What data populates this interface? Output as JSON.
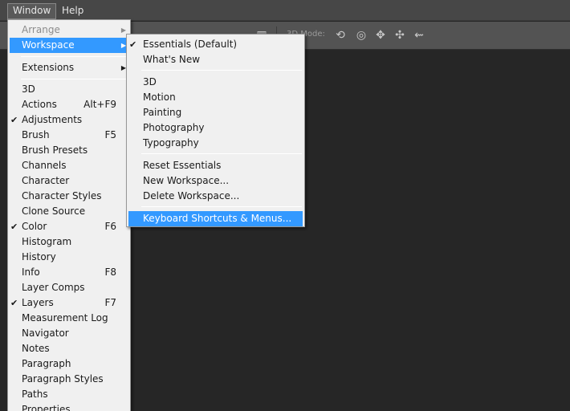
{
  "menubar": {
    "items": [
      "Window",
      "Help"
    ]
  },
  "options_bar": {
    "mode_label": "3D Mode:",
    "icons": [
      "layout-icon",
      "3d-rotate-icon",
      "3d-roll-icon",
      "3d-pan-icon",
      "3d-slide-icon",
      "3d-scale-icon"
    ]
  },
  "window_menu": {
    "arrange": "Arrange",
    "workspace": "Workspace",
    "extensions": "Extensions",
    "items": [
      {
        "label": "3D",
        "shortcut": "",
        "checked": false
      },
      {
        "label": "Actions",
        "shortcut": "Alt+F9",
        "checked": false
      },
      {
        "label": "Adjustments",
        "shortcut": "",
        "checked": true
      },
      {
        "label": "Brush",
        "shortcut": "F5",
        "checked": false
      },
      {
        "label": "Brush Presets",
        "shortcut": "",
        "checked": false
      },
      {
        "label": "Channels",
        "shortcut": "",
        "checked": false
      },
      {
        "label": "Character",
        "shortcut": "",
        "checked": false
      },
      {
        "label": "Character Styles",
        "shortcut": "",
        "checked": false
      },
      {
        "label": "Clone Source",
        "shortcut": "",
        "checked": false
      },
      {
        "label": "Color",
        "shortcut": "F6",
        "checked": true
      },
      {
        "label": "Histogram",
        "shortcut": "",
        "checked": false
      },
      {
        "label": "History",
        "shortcut": "",
        "checked": false
      },
      {
        "label": "Info",
        "shortcut": "F8",
        "checked": false
      },
      {
        "label": "Layer Comps",
        "shortcut": "",
        "checked": false
      },
      {
        "label": "Layers",
        "shortcut": "F7",
        "checked": true
      },
      {
        "label": "Measurement Log",
        "shortcut": "",
        "checked": false
      },
      {
        "label": "Navigator",
        "shortcut": "",
        "checked": false
      },
      {
        "label": "Notes",
        "shortcut": "",
        "checked": false
      },
      {
        "label": "Paragraph",
        "shortcut": "",
        "checked": false
      },
      {
        "label": "Paragraph Styles",
        "shortcut": "",
        "checked": false
      },
      {
        "label": "Paths",
        "shortcut": "",
        "checked": false
      },
      {
        "label": "Properties",
        "shortcut": "",
        "checked": false
      }
    ]
  },
  "workspace_menu": {
    "presets": [
      {
        "label": "Essentials (Default)",
        "checked": true
      },
      {
        "label": "What's New",
        "checked": false
      }
    ],
    "workspaces": [
      "3D",
      "Motion",
      "Painting",
      "Photography",
      "Typography"
    ],
    "actions": [
      "Reset Essentials",
      "New Workspace...",
      "Delete Workspace..."
    ],
    "shortcuts": "Keyboard Shortcuts & Menus..."
  },
  "glyphs": {
    "check": "✔",
    "submenu_arrow": "▶"
  }
}
